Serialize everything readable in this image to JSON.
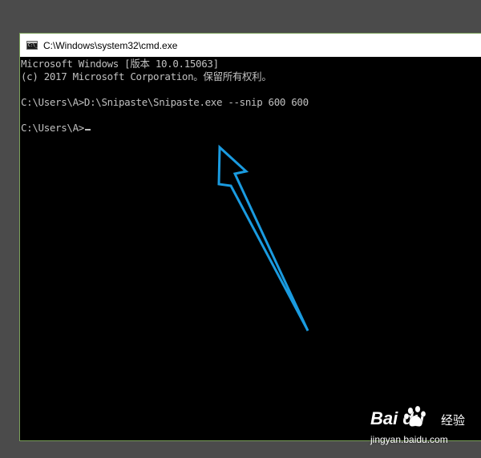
{
  "window": {
    "title": "C:\\Windows\\system32\\cmd.exe",
    "icon": "cmd-app-icon",
    "icon_text": "C:\\_"
  },
  "console": {
    "lines": [
      "Microsoft Windows [版本 10.0.15063]",
      "(c) 2017 Microsoft Corporation。保留所有权利。",
      "",
      "C:\\Users\\A>D:\\Snipaste\\Snipaste.exe --snip 600 600",
      "",
      "C:\\Users\\A>"
    ]
  },
  "annotation": {
    "type": "arrow",
    "color": "#1a9be0"
  },
  "watermark": {
    "logo_text": "Bai du",
    "logo_cn": "经验",
    "url": "jingyan.baidu.com"
  }
}
